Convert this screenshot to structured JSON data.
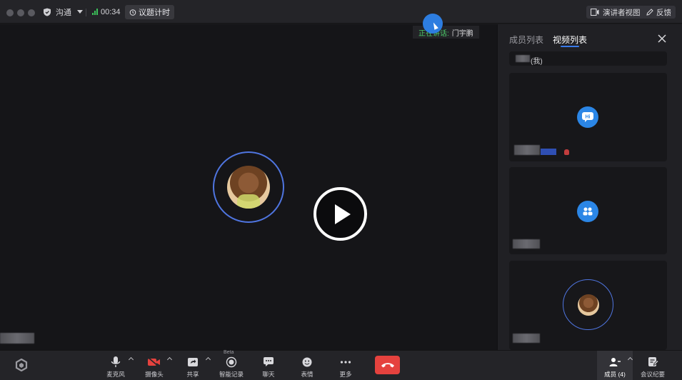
{
  "window": {
    "meeting_label": "沟通",
    "timer": "00:34",
    "agenda_timer_label": "议题计时"
  },
  "header_right": {
    "presenter_view_label": "演讲者视图",
    "feedback_label": "反馈"
  },
  "stage": {
    "speaking_label": "正在讲话:",
    "speaking_name": "门宇鹏"
  },
  "panel": {
    "tabs": [
      {
        "label": "成员列表",
        "active": false
      },
      {
        "label": "视频列表",
        "active": true
      }
    ],
    "self_label": "(我)"
  },
  "toolbar": {
    "items": [
      {
        "label": "麦克风",
        "icon": "microphone-icon"
      },
      {
        "label": "摄像头",
        "icon": "camera-off-icon"
      },
      {
        "label": "共享",
        "icon": "share-icon"
      },
      {
        "label": "智能记录",
        "icon": "record-icon",
        "badge": "Beta"
      },
      {
        "label": "聊天",
        "icon": "chat-icon"
      },
      {
        "label": "表情",
        "icon": "emoji-icon"
      },
      {
        "label": "更多",
        "icon": "more-icon"
      }
    ],
    "members_label": "成员 (4)",
    "notes_label": "会议纪要"
  },
  "colors": {
    "accent": "#3a7ae8",
    "speaking": "#4cc96a",
    "hangup": "#e5423e",
    "ring": "#4f75e0"
  }
}
